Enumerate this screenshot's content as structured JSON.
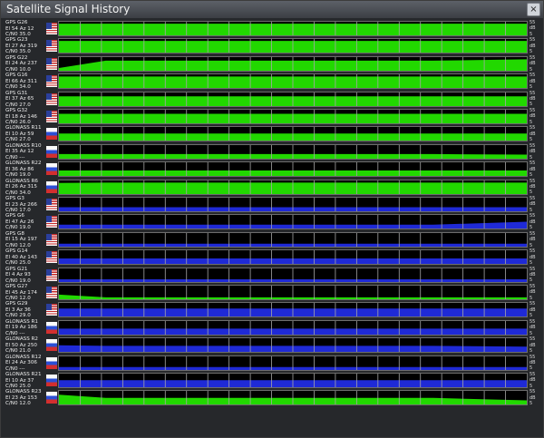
{
  "window": {
    "title": "Satellite Signal History",
    "close_label": "×"
  },
  "colors": {
    "green": "#22d800",
    "blue": "#1f2ad6",
    "grid": "#a6a6a6",
    "background": "#000000"
  },
  "scale": {
    "top": "55",
    "mid": "dB",
    "bottom": "5"
  },
  "satellites": [
    {
      "name": "GPS G26",
      "pos": "El 54 Az 12",
      "cn": "C/N0 35.0",
      "flag": "us",
      "color": "green",
      "level": [
        0.86,
        0.86,
        0.86
      ]
    },
    {
      "name": "GPS G23",
      "pos": "El 27 Az 319",
      "cn": "C/N0 35.0",
      "flag": "us",
      "color": "green",
      "level": [
        0.86,
        0.86,
        0.86
      ]
    },
    {
      "name": "GPS G22",
      "pos": "El 24 Az 237",
      "cn": "C/N0 10.0",
      "flag": "us",
      "color": "green",
      "level": [
        0.2,
        0.74,
        0.84
      ]
    },
    {
      "name": "GPS G16",
      "pos": "El 66 Az 311",
      "cn": "C/N0 34.0",
      "flag": "us",
      "color": "green",
      "level": [
        0.84,
        0.84,
        0.84
      ]
    },
    {
      "name": "GPS G31",
      "pos": "El 37 Az 65",
      "cn": "C/N0 27.0",
      "flag": "us",
      "color": "green",
      "level": [
        0.72,
        0.72,
        0.72
      ]
    },
    {
      "name": "GPS G32",
      "pos": "El 18 Az 146",
      "cn": "C/N0 26.0",
      "flag": "us",
      "color": "green",
      "level": [
        0.7,
        0.7,
        0.7
      ]
    },
    {
      "name": "GLONASS R11",
      "pos": "El 10 Az 59",
      "cn": "C/N0 27.0",
      "flag": "ru",
      "color": "green",
      "level": [
        0.52,
        0.52,
        0.52
      ]
    },
    {
      "name": "GLONASS R10",
      "pos": "El 35 Az 12",
      "cn": "C/N0 ---",
      "flag": "ru",
      "color": "green",
      "level": [
        0.34,
        0.34,
        0.3
      ]
    },
    {
      "name": "GLONASS R22",
      "pos": "El 36 Az 86",
      "cn": "C/N0 19.0",
      "flag": "ru",
      "color": "green",
      "level": [
        0.4,
        0.4,
        0.4
      ]
    },
    {
      "name": "GLONASS R6",
      "pos": "El 26 Az 315",
      "cn": "C/N0 34.0",
      "flag": "ru",
      "color": "green",
      "level": [
        0.82,
        0.84,
        0.84
      ]
    },
    {
      "name": "GPS G3",
      "pos": "El 23 Az 266",
      "cn": "C/N0 17.0",
      "flag": "us",
      "color": "blue",
      "level": [
        0.3,
        0.3,
        0.3
      ]
    },
    {
      "name": "GPS G6",
      "pos": "El 47 Az 26",
      "cn": "C/N0 19.0",
      "flag": "us",
      "color": "blue",
      "level": [
        0.28,
        0.28,
        0.5
      ]
    },
    {
      "name": "GPS G8",
      "pos": "El 15 Az 197",
      "cn": "C/N0 12.0",
      "flag": "us",
      "color": "blue",
      "level": [
        0.22,
        0.22,
        0.22
      ]
    },
    {
      "name": "GPS G14",
      "pos": "El 40 Az 143",
      "cn": "C/N0 25.0",
      "flag": "us",
      "color": "blue",
      "level": [
        0.4,
        0.4,
        0.4
      ]
    },
    {
      "name": "GPS G21",
      "pos": "El 4 Az 93",
      "cn": "C/N0 19.0",
      "flag": "us",
      "color": "blue",
      "level": [
        0.2,
        0.2,
        0.2
      ]
    },
    {
      "name": "GPS G27",
      "pos": "El 45 Az 174",
      "cn": "C/N0 12.0",
      "flag": "us",
      "color": "green",
      "level": [
        0.34,
        0.14,
        0.14
      ]
    },
    {
      "name": "GPS G29",
      "pos": "El 3 Az 36",
      "cn": "C/N0 29.0",
      "flag": "us",
      "color": "blue",
      "level": [
        0.58,
        0.58,
        0.58
      ]
    },
    {
      "name": "GLONASS R1",
      "pos": "El 19 Az 186",
      "cn": "C/N0 ---",
      "flag": "ru",
      "color": "blue",
      "level": [
        0.44,
        0.44,
        0.44
      ]
    },
    {
      "name": "GLONASS R2",
      "pos": "El 50 Az 250",
      "cn": "C/N0 21.0",
      "flag": "ru",
      "color": "blue",
      "level": [
        0.48,
        0.44,
        0.38
      ]
    },
    {
      "name": "GLONASS R12",
      "pos": "El 24 Az 306",
      "cn": "C/N0 ---",
      "flag": "ru",
      "color": "blue",
      "level": [
        0.22,
        0.22,
        0.22
      ]
    },
    {
      "name": "GLONASS R21",
      "pos": "El 10 Az 37",
      "cn": "C/N0 25.0",
      "flag": "ru",
      "color": "blue",
      "level": [
        0.52,
        0.52,
        0.52
      ]
    },
    {
      "name": "GLONASS R23",
      "pos": "El 23 Az 153",
      "cn": "C/N0 12.0",
      "flag": "ru",
      "color": "green",
      "level": [
        0.72,
        0.48,
        0.3
      ]
    }
  ]
}
